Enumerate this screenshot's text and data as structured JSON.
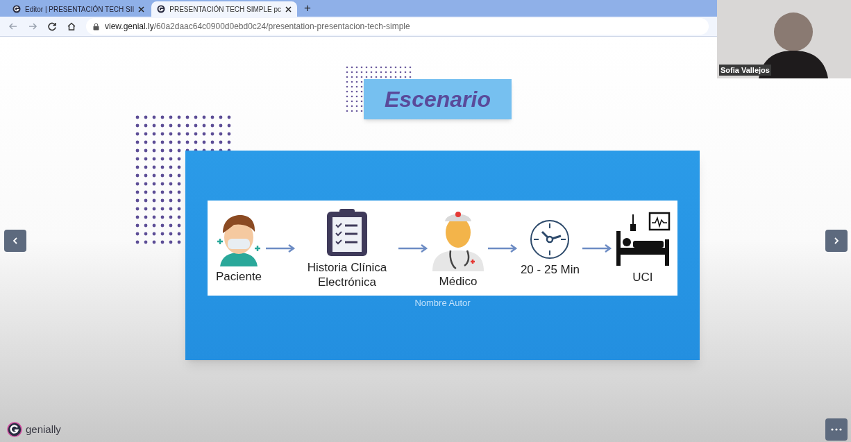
{
  "browser": {
    "tabs": [
      {
        "title": "Editor | PRESENTACIÓN TECH SII",
        "selected": false
      },
      {
        "title": "PRESENTACIÓN TECH SIMPLE pc",
        "selected": true
      }
    ],
    "new_tab": "+",
    "address": {
      "host": "view.genial.ly",
      "path": "/60a2daac64c0900d0ebd0c24/presentation-presentacion-tech-simple"
    }
  },
  "slide": {
    "title": "Escenario",
    "author": "Nombre Autor",
    "steps": [
      {
        "kind": "patient",
        "label": "Paciente"
      },
      {
        "kind": "record",
        "label": "Historia Clínica Electrónica"
      },
      {
        "kind": "doctor",
        "label": "Médico"
      },
      {
        "kind": "clock",
        "label": "20 - 25 Min"
      },
      {
        "kind": "icu",
        "label": "UCI"
      }
    ]
  },
  "brand": "genially",
  "video": {
    "name": "Sofia Vallejos"
  }
}
